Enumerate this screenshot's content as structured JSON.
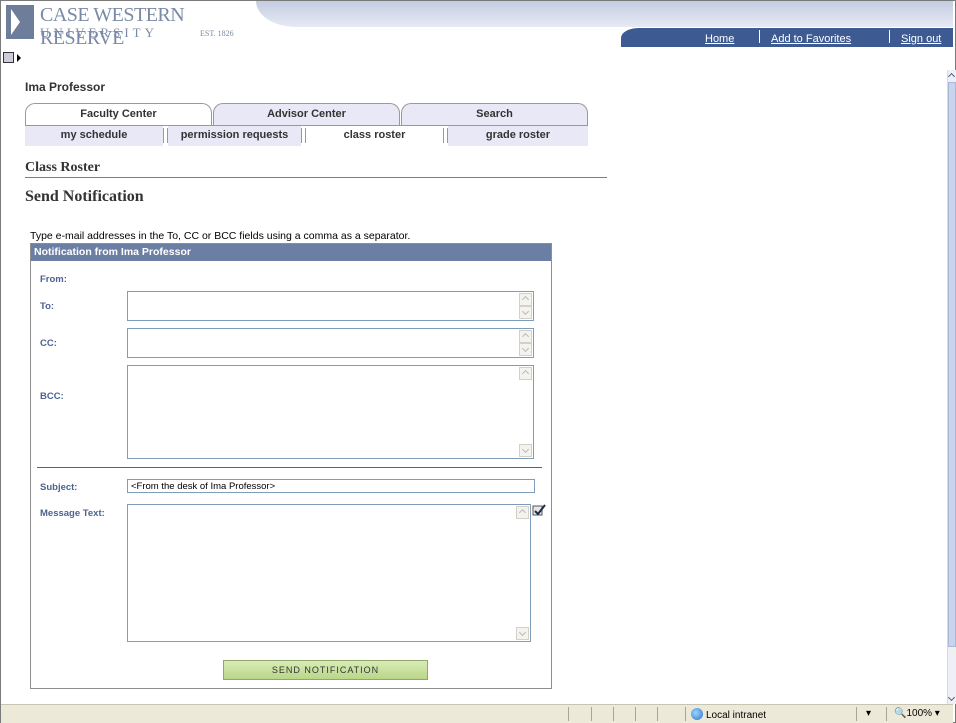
{
  "header": {
    "logo_line1": "CASE WESTERN RESERVE",
    "logo_line2": "UNIVERSITY",
    "logo_est": "EST. 1826",
    "links": [
      "Home",
      "Add to Favorites",
      "Sign out"
    ]
  },
  "user": {
    "name": "Ima Professor"
  },
  "tabs": [
    {
      "label": "Faculty Center",
      "active": true
    },
    {
      "label": "Advisor Center",
      "active": false
    },
    {
      "label": "Search",
      "active": false
    }
  ],
  "subtabs": [
    {
      "label": "my schedule",
      "active": false
    },
    {
      "label": "permission requests",
      "active": false
    },
    {
      "label": "class roster",
      "active": true
    },
    {
      "label": "grade roster",
      "active": false
    }
  ],
  "page": {
    "title": "Class Roster",
    "section_title": "Send Notification",
    "instructions": "Type e-mail addresses in the To, CC or BCC fields using a comma as a separator."
  },
  "form": {
    "header": "Notification from Ima Professor",
    "from_label": "From:",
    "to_label": "To:",
    "cc_label": "CC:",
    "bcc_label": "BCC:",
    "subject_label": "Subject:",
    "subject_value": "<From the desk of Ima Professor>",
    "message_label": "Message Text:",
    "send_button": "SEND NOTIFICATION"
  },
  "status_bar": {
    "zone": "Local intranet",
    "zoom": "100%",
    "zone_icon": "globe-icon",
    "security_icon": "lock-icon"
  },
  "colors": {
    "header_bar": "#3d5a92",
    "section_header": "#6b7fa5",
    "label_text": "#4b6390",
    "button_green": "#c6df9c"
  }
}
